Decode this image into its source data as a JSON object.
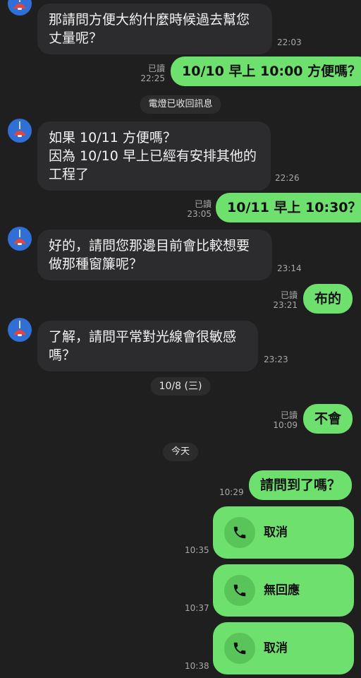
{
  "messages": {
    "in1": {
      "lines": [
        "那請問方便大約什麼時候過去幫您",
        "丈量呢？"
      ],
      "time": "22:03"
    },
    "out1": {
      "text": "10/10 早上 10:00 方便嗎？",
      "read": "已讀",
      "time": "22:25"
    },
    "system1": "電燈已收回訊息",
    "in2": {
      "lines": [
        "如果 10/11 方便嗎？",
        "因為 10/10 早上已經有安排其他的",
        "工程了"
      ],
      "time": "22:26"
    },
    "out2": {
      "text": "10/11 早上 10:30？",
      "read": "已讀",
      "time": "23:05"
    },
    "in3": {
      "lines": [
        "好的，請問您那邊目前會比較想要",
        "做那種窗簾呢？"
      ],
      "time": "23:14"
    },
    "out3": {
      "text": "布的",
      "read": "已讀",
      "time": "23:21"
    },
    "in4": {
      "lines": [
        "了解，請問平常對光線會很敏感",
        "嗎？"
      ],
      "time": "23:23"
    },
    "date1": "10/8 (三)",
    "out4": {
      "text": "不會",
      "read": "已讀",
      "time": "10:09"
    },
    "date2": "今天",
    "out5": {
      "text": "請問到了嗎？",
      "time": "10:29"
    },
    "calls": [
      {
        "label": "取消",
        "time": "10:35",
        "icon": "phone-icon"
      },
      {
        "label": "無回應",
        "time": "10:37",
        "icon": "phone-icon"
      },
      {
        "label": "取消",
        "time": "10:38",
        "icon": "phone-icon"
      }
    ]
  },
  "colors": {
    "background": "#1f1f1f",
    "incoming_bubble": "#2c2c2e",
    "outgoing_bubble": "#6ee06e",
    "avatar": "#2f6fd6",
    "avatar_lamp": "#e8443a"
  }
}
